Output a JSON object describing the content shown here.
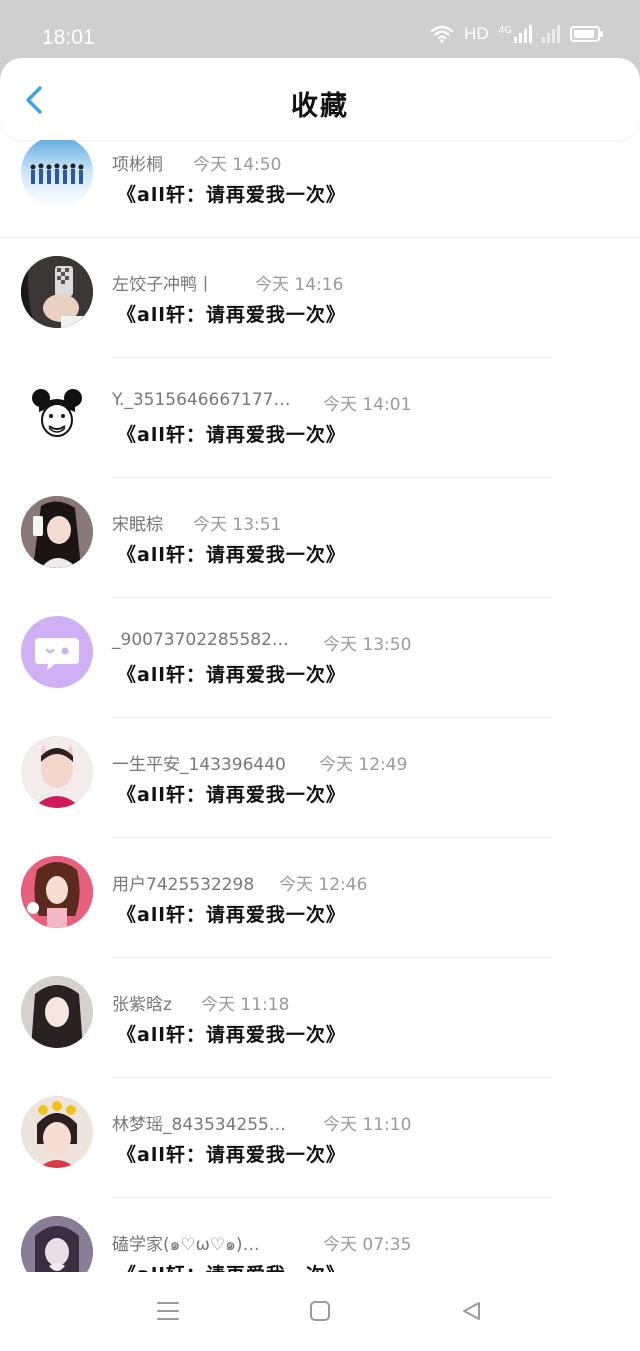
{
  "status_bar": {
    "time": "18:01",
    "network_label": "HD",
    "signal_label": "4G"
  },
  "header": {
    "title": "收藏"
  },
  "favorites": [
    {
      "name": "项彬桐",
      "time": "今天 14:50",
      "message": "《all轩：请再爱我一次》",
      "avatar_color": "#9cc6e8"
    },
    {
      "name": "左饺子冲鸭丨",
      "time": "今天 14:16",
      "message": "《all轩：请再爱我一次》",
      "avatar_color": "#3a3a3a"
    },
    {
      "name": "Y._3515646667177…",
      "time": "今天 14:01",
      "message": "《all轩：请再爱我一次》",
      "avatar_color": "#ffffff"
    },
    {
      "name": "宋眠棕",
      "time": "今天 13:51",
      "message": "《all轩：请再爱我一次》",
      "avatar_color": "#5a4a4a"
    },
    {
      "name": "_90073702285582…",
      "time": "今天 13:50",
      "message": "《all轩：请再爱我一次》",
      "avatar_color": "#c9a6f0"
    },
    {
      "name": "一生平安_143396440",
      "time": "今天 12:49",
      "message": "《all轩：请再爱我一次》",
      "avatar_color": "#d9b8b8"
    },
    {
      "name": "用户7425532298",
      "time": "今天 12:46",
      "message": "《all轩：请再爱我一次》",
      "avatar_color": "#e0607a"
    },
    {
      "name": "张紫晗z",
      "time": "今天 11:18",
      "message": "《all轩：请再爱我一次》",
      "avatar_color": "#bdb6b6"
    },
    {
      "name": "林梦瑶_843534255…",
      "time": "今天 11:10",
      "message": "《all轩：请再爱我一次》",
      "avatar_color": "#e8d2c4"
    },
    {
      "name": "磕学家(๑♡ω♡๑)…",
      "time": "今天 07:35",
      "message": "《all轩：请再爱我一次》",
      "avatar_color": "#8a7a9a"
    }
  ],
  "colors": {
    "accent": "#3aa0f0",
    "status_bar": "#cfcfcf"
  }
}
